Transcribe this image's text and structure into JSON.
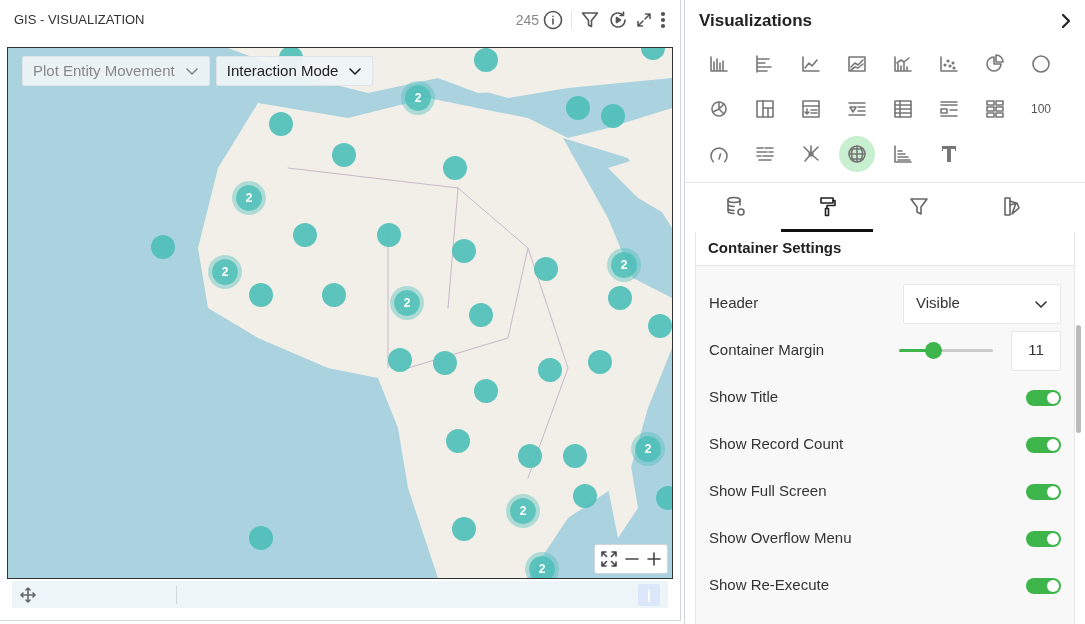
{
  "widget": {
    "title": "GIS - VISUALIZATION",
    "record_count": "245"
  },
  "map": {
    "dropdowns": [
      {
        "label": "Plot Entity Movement",
        "disabled": true
      },
      {
        "label": "Interaction Mode",
        "disabled": false
      }
    ],
    "clusters": [
      {
        "count": "2"
      },
      {
        "count": "2"
      },
      {
        "count": "2"
      },
      {
        "count": "2"
      },
      {
        "count": "2"
      },
      {
        "count": "2"
      },
      {
        "count": "2"
      },
      {
        "count": "2"
      }
    ]
  },
  "panel": {
    "title": "Visualizations",
    "visualizations": [
      {
        "selected": false
      },
      {
        "selected": false
      },
      {
        "selected": false
      },
      {
        "selected": false
      },
      {
        "selected": false
      },
      {
        "selected": false
      },
      {
        "selected": false
      },
      {
        "selected": false
      },
      {
        "selected": false
      },
      {
        "selected": false
      },
      {
        "selected": false
      },
      {
        "selected": false
      },
      {
        "selected": false
      },
      {
        "selected": false
      },
      {
        "selected": false
      },
      {
        "label": "100",
        "selected": false
      },
      {
        "selected": false
      },
      {
        "selected": false
      },
      {
        "selected": false
      },
      {
        "selected": true
      },
      {
        "selected": false
      },
      {
        "selected": false
      }
    ],
    "tabs": [
      {
        "selected": false
      },
      {
        "selected": true
      },
      {
        "selected": false
      },
      {
        "selected": false
      }
    ],
    "section_title": "Container Settings",
    "settings": [
      {
        "kind": "select",
        "label": "Header",
        "value": "Visible"
      },
      {
        "kind": "slider",
        "label": "Container Margin",
        "level": 0.34,
        "value": "11"
      },
      {
        "kind": "toggle",
        "label": "Show Title",
        "on": true
      },
      {
        "kind": "toggle",
        "label": "Show Record Count",
        "on": true
      },
      {
        "kind": "toggle",
        "label": "Show Full Screen",
        "on": true
      },
      {
        "kind": "toggle",
        "label": "Show Overflow Menu",
        "on": true
      },
      {
        "kind": "toggle",
        "label": "Show Re-Execute",
        "on": true
      }
    ]
  }
}
